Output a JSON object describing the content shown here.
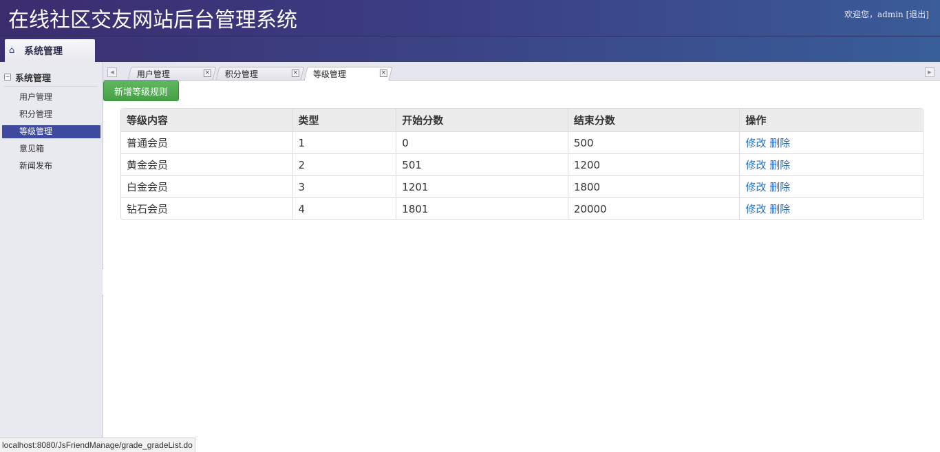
{
  "header": {
    "title": "在线社区交友网站后台管理系统",
    "welcome": "欢迎您，admin",
    "logout": "[退出]"
  },
  "module_tab": {
    "label": "系统管理",
    "icon": "home-icon"
  },
  "sidebar": {
    "group_label": "系统管理",
    "items": [
      {
        "label": "用户管理",
        "active": false
      },
      {
        "label": "积分管理",
        "active": false
      },
      {
        "label": "等级管理",
        "active": true
      },
      {
        "label": "意见箱",
        "active": false
      },
      {
        "label": "新闻发布",
        "active": false
      }
    ]
  },
  "tabs": [
    {
      "label": "用户管理",
      "active": false
    },
    {
      "label": "积分管理",
      "active": false
    },
    {
      "label": "等级管理",
      "active": true
    }
  ],
  "toolbar": {
    "add_label": "新增等级规则"
  },
  "table": {
    "headers": [
      "等级内容",
      "类型",
      "开始分数",
      "结束分数",
      "操作"
    ],
    "rows": [
      [
        "普通会员",
        "1",
        "0",
        "500"
      ],
      [
        "黄金会员",
        "2",
        "501",
        "1200"
      ],
      [
        "白金会员",
        "3",
        "1201",
        "1800"
      ],
      [
        "钻石会员",
        "4",
        "1801",
        "20000"
      ]
    ],
    "edit_label": "修改",
    "delete_label": "删除"
  },
  "status_bar": {
    "url": "localhost:8080/JsFriendManage/grade_gradeList.do"
  },
  "colors": {
    "header_bg": "#3b3f86",
    "active_item": "#3e4a9e",
    "add_button": "#4caf50",
    "link": "#2a6eb8"
  }
}
